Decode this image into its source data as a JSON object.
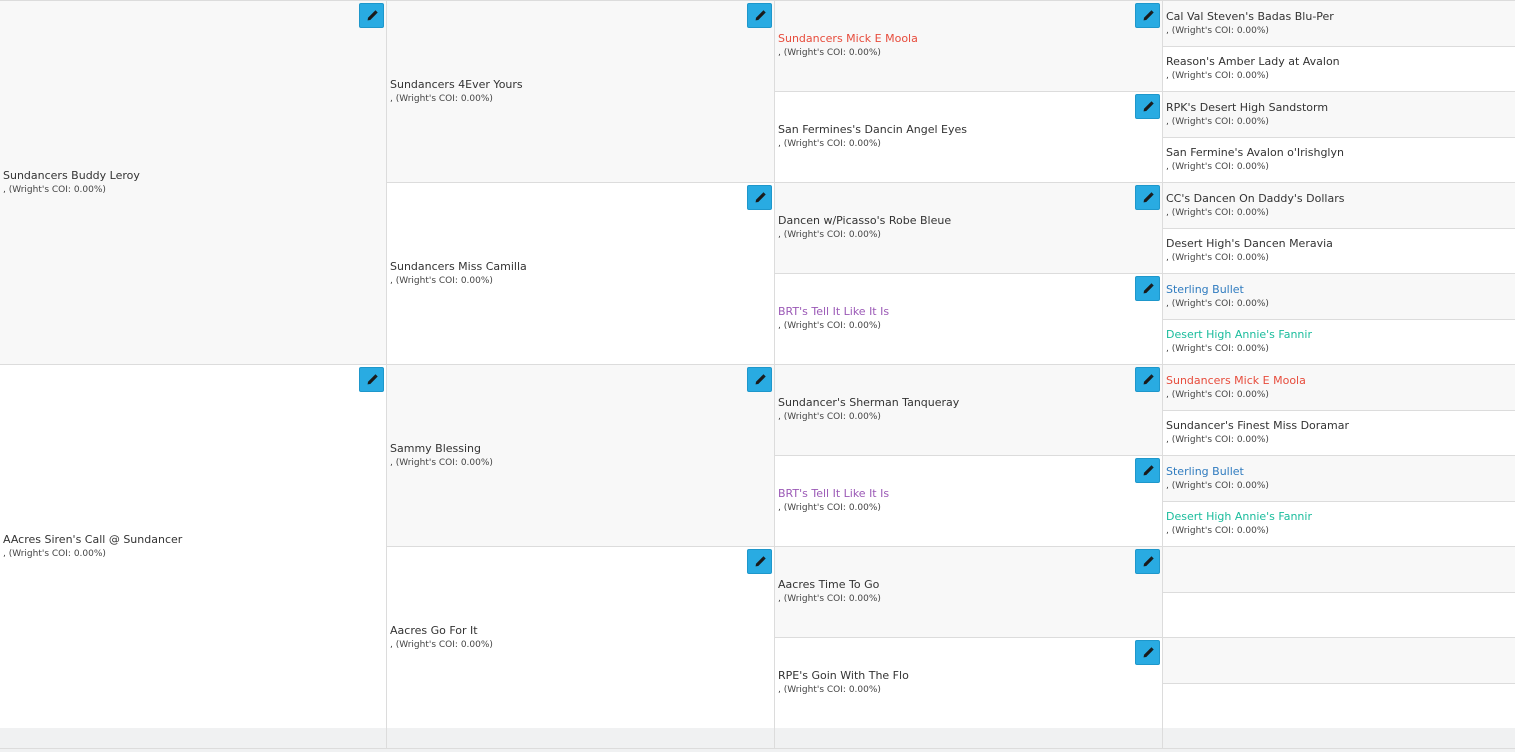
{
  "coi_label": ", (Wright's COI: 0.00%)",
  "colors": {
    "edit_button": "#29abe2",
    "name_default": "#333333",
    "name_red": "#e74c3c",
    "name_purple": "#9b59b6",
    "name_blue": "#2f7bbf",
    "name_green": "#1abc9c"
  },
  "icons": {
    "edit": "pencil-icon"
  },
  "pedigree": {
    "generation1": [
      {
        "name": "Sundancers Buddy Leroy",
        "coi": ", (Wright's COI: 0.00%)",
        "color": "default",
        "editable": true
      },
      {
        "name": "AAcres Siren's Call @ Sundancer",
        "coi": ", (Wright's COI: 0.00%)",
        "color": "default",
        "editable": true
      }
    ],
    "generation2": [
      {
        "name": "Sundancers 4Ever Yours",
        "coi": ", (Wright's COI: 0.00%)",
        "color": "default",
        "editable": true
      },
      {
        "name": "Sundancers Miss Camilla",
        "coi": ", (Wright's COI: 0.00%)",
        "color": "default",
        "editable": true
      },
      {
        "name": "Sammy Blessing",
        "coi": ", (Wright's COI: 0.00%)",
        "color": "default",
        "editable": true
      },
      {
        "name": "Aacres Go For It",
        "coi": ", (Wright's COI: 0.00%)",
        "color": "default",
        "editable": true
      }
    ],
    "generation3": [
      {
        "name": "Sundancers Mick E Moola",
        "coi": ", (Wright's COI: 0.00%)",
        "color": "red",
        "editable": true
      },
      {
        "name": "San Fermines's Dancin Angel Eyes",
        "coi": ", (Wright's COI: 0.00%)",
        "color": "default",
        "editable": true
      },
      {
        "name": "Dancen w/Picasso's Robe Bleue",
        "coi": ", (Wright's COI: 0.00%)",
        "color": "default",
        "editable": true
      },
      {
        "name": "BRT's Tell It Like It Is",
        "coi": ", (Wright's COI: 0.00%)",
        "color": "purple",
        "editable": true
      },
      {
        "name": "Sundancer's Sherman Tanqueray",
        "coi": ", (Wright's COI: 0.00%)",
        "color": "default",
        "editable": true
      },
      {
        "name": "BRT's Tell It Like It Is",
        "coi": ", (Wright's COI: 0.00%)",
        "color": "purple",
        "editable": true
      },
      {
        "name": "Aacres Time To Go",
        "coi": ", (Wright's COI: 0.00%)",
        "color": "default",
        "editable": true
      },
      {
        "name": "RPE's Goin With The Flo",
        "coi": ", (Wright's COI: 0.00%)",
        "color": "default",
        "editable": true
      }
    ],
    "generation4": [
      {
        "name": "Cal Val Steven's Badas Blu-Per",
        "coi": ", (Wright's COI: 0.00%)",
        "color": "default"
      },
      {
        "name": "Reason's Amber Lady at Avalon",
        "coi": ", (Wright's COI: 0.00%)",
        "color": "default"
      },
      {
        "name": "RPK's Desert High Sandstorm",
        "coi": ", (Wright's COI: 0.00%)",
        "color": "default"
      },
      {
        "name": "San Fermine's Avalon o'Irishglyn",
        "coi": ", (Wright's COI: 0.00%)",
        "color": "default"
      },
      {
        "name": "CC's Dancen On Daddy's Dollars",
        "coi": ", (Wright's COI: 0.00%)",
        "color": "default"
      },
      {
        "name": "Desert High's Dancen Meravia",
        "coi": ", (Wright's COI: 0.00%)",
        "color": "default"
      },
      {
        "name": "Sterling Bullet",
        "coi": ", (Wright's COI: 0.00%)",
        "color": "blue"
      },
      {
        "name": "Desert High Annie's Fannir",
        "coi": ", (Wright's COI: 0.00%)",
        "color": "green"
      },
      {
        "name": "Sundancers Mick E Moola",
        "coi": ", (Wright's COI: 0.00%)",
        "color": "red"
      },
      {
        "name": "Sundancer's Finest Miss Doramar",
        "coi": ", (Wright's COI: 0.00%)",
        "color": "default"
      },
      {
        "name": "Sterling Bullet",
        "coi": ", (Wright's COI: 0.00%)",
        "color": "blue"
      },
      {
        "name": "Desert High Annie's Fannir",
        "coi": ", (Wright's COI: 0.00%)",
        "color": "green"
      },
      {
        "name": "",
        "coi": "",
        "color": "default"
      },
      {
        "name": "",
        "coi": "",
        "color": "default"
      },
      {
        "name": "",
        "coi": "",
        "color": "default"
      },
      {
        "name": "",
        "coi": "",
        "color": "default"
      }
    ]
  }
}
